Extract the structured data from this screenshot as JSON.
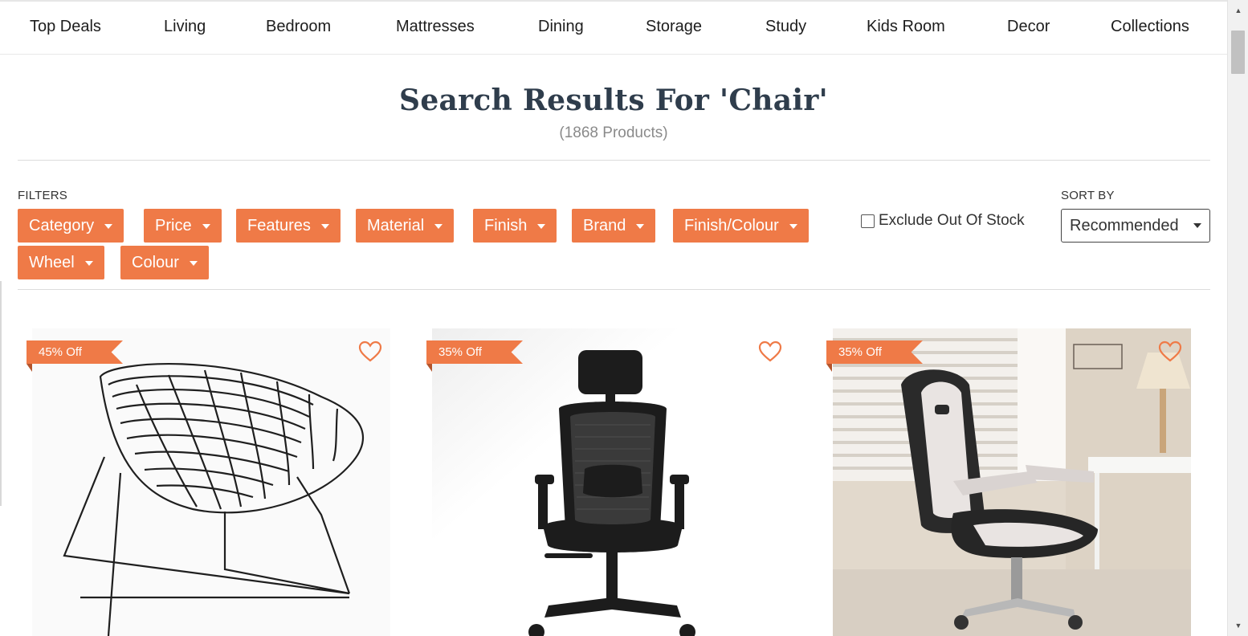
{
  "nav": {
    "items": [
      "Top Deals",
      "Living",
      "Bedroom",
      "Mattresses",
      "Dining",
      "Storage",
      "Study",
      "Kids Room",
      "Decor",
      "Collections"
    ]
  },
  "search": {
    "title": "Search Results For 'Chair'",
    "count": "(1868 Products)"
  },
  "filters": {
    "label": "FILTERS",
    "buttons": [
      "Category",
      "Price",
      "Features",
      "Material",
      "Finish",
      "Brand",
      "Finish/Colour",
      "Wheel",
      "Colour"
    ],
    "exclude_out_of_stock": {
      "label": "Exclude Out Of Stock",
      "checked": false
    }
  },
  "sort": {
    "label": "SORT BY",
    "selected": "Recommended"
  },
  "products": [
    {
      "discount": "45% Off",
      "image": "wire-lounge-chair"
    },
    {
      "discount": "35% Off",
      "image": "office-chair"
    },
    {
      "discount": "35% Off",
      "image": "gaming-chair"
    }
  ],
  "colors": {
    "accent": "#ef7a47",
    "title": "#2f3d4c"
  }
}
